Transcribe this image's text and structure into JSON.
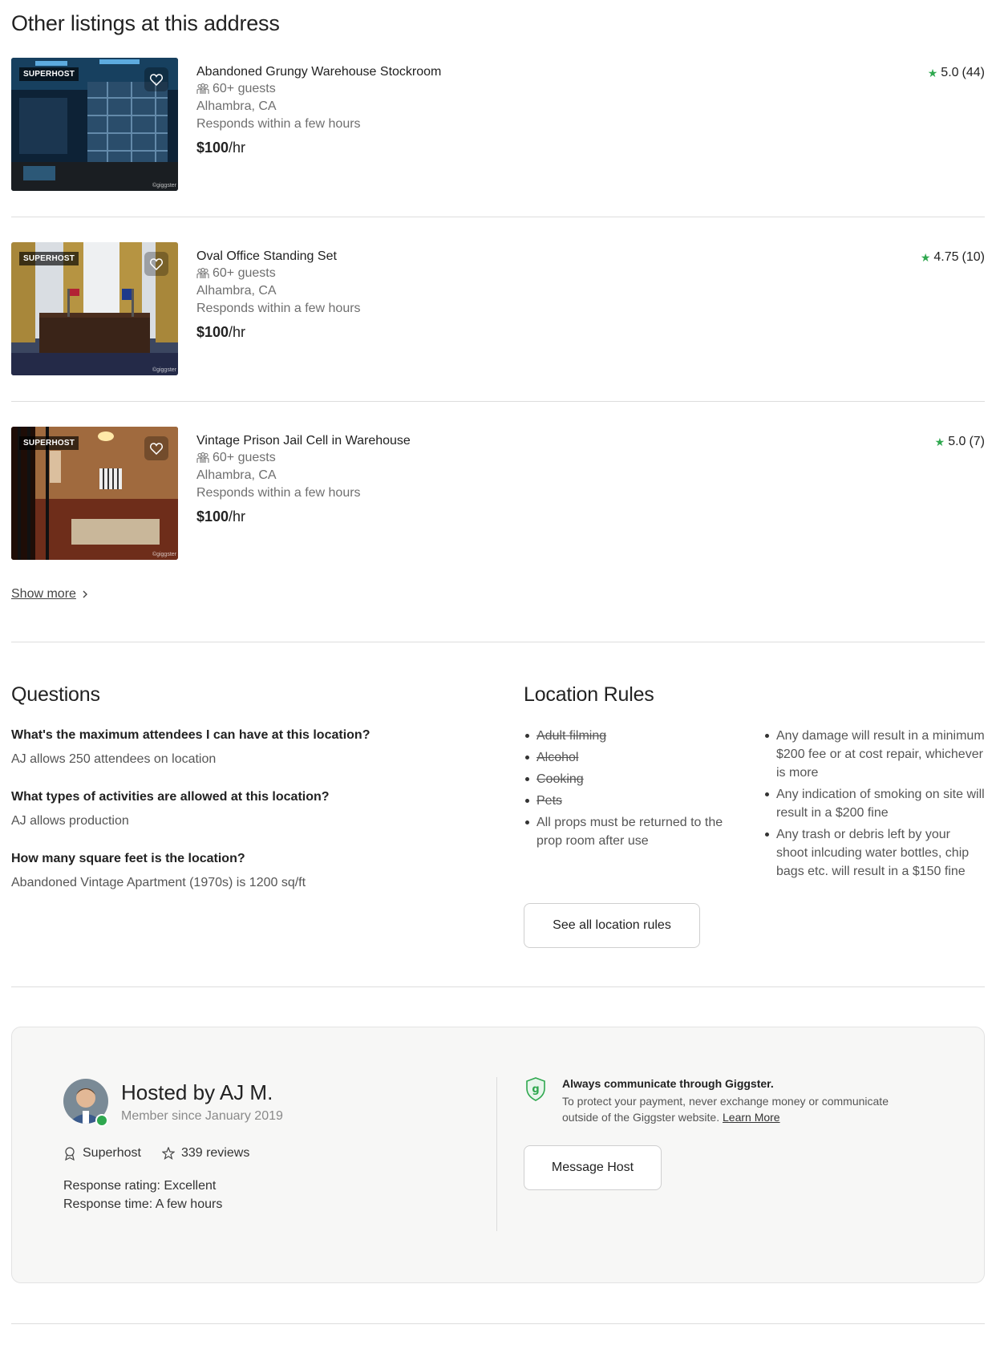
{
  "listings_section": {
    "title": "Other listings at this address",
    "show_more": "Show more",
    "items": [
      {
        "title": "Abandoned Grungy Warehouse Stockroom",
        "guests": "60+ guests",
        "location": "Alhambra, CA",
        "response": "Responds within a few hours",
        "price": "$100",
        "price_unit": "/hr",
        "rating": "5.0",
        "reviews": "(44)",
        "badge": "SUPERHOST",
        "watermark": "©giggster"
      },
      {
        "title": "Oval Office Standing Set",
        "guests": "60+ guests",
        "location": "Alhambra, CA",
        "response": "Responds within a few hours",
        "price": "$100",
        "price_unit": "/hr",
        "rating": "4.75",
        "reviews": "(10)",
        "badge": "SUPERHOST",
        "watermark": "©giggster"
      },
      {
        "title": "Vintage Prison Jail Cell in Warehouse",
        "guests": "60+ guests",
        "location": "Alhambra, CA",
        "response": "Responds within a few hours",
        "price": "$100",
        "price_unit": "/hr",
        "rating": "5.0",
        "reviews": "(7)",
        "badge": "SUPERHOST",
        "watermark": "©giggster"
      }
    ]
  },
  "questions": {
    "title": "Questions",
    "items": [
      {
        "q": "What's the maximum attendees I can have at this location?",
        "a": "AJ allows 250 attendees on location"
      },
      {
        "q": "What types of activities are allowed at this location?",
        "a": "AJ allows production"
      },
      {
        "q": "How many square feet is the location?",
        "a": "Abandoned Vintage Apartment (1970s) is 1200 sq/ft"
      }
    ]
  },
  "rules": {
    "title": "Location Rules",
    "left": [
      "Adult filming",
      "Alcohol",
      "Cooking",
      "Pets",
      "All props must be returned to the prop room after use"
    ],
    "right": [
      "Any damage will result in a minimum $200 fee or at cost repair, whichever is more",
      "Any indication of smoking on site will result in a $200 fine",
      "Any trash or debris left by your shoot inlcuding water bottles, chip bags etc. will result in a $150 fine"
    ],
    "see_all": "See all location rules"
  },
  "host": {
    "name": "Hosted by AJ M.",
    "member_since": "Member since January 2019",
    "superhost": "Superhost",
    "reviews": "339 reviews",
    "response_rating": "Response rating: Excellent",
    "response_time": "Response time: A few hours",
    "comm_title": "Always communicate through Giggster.",
    "comm_text": "To protect your payment, never exchange money or communicate outside of the Giggster website.",
    "learn_more": "Learn More",
    "message_button": "Message Host"
  },
  "colors": {
    "star": "#2fa84f",
    "shield": "#2fa84f"
  }
}
